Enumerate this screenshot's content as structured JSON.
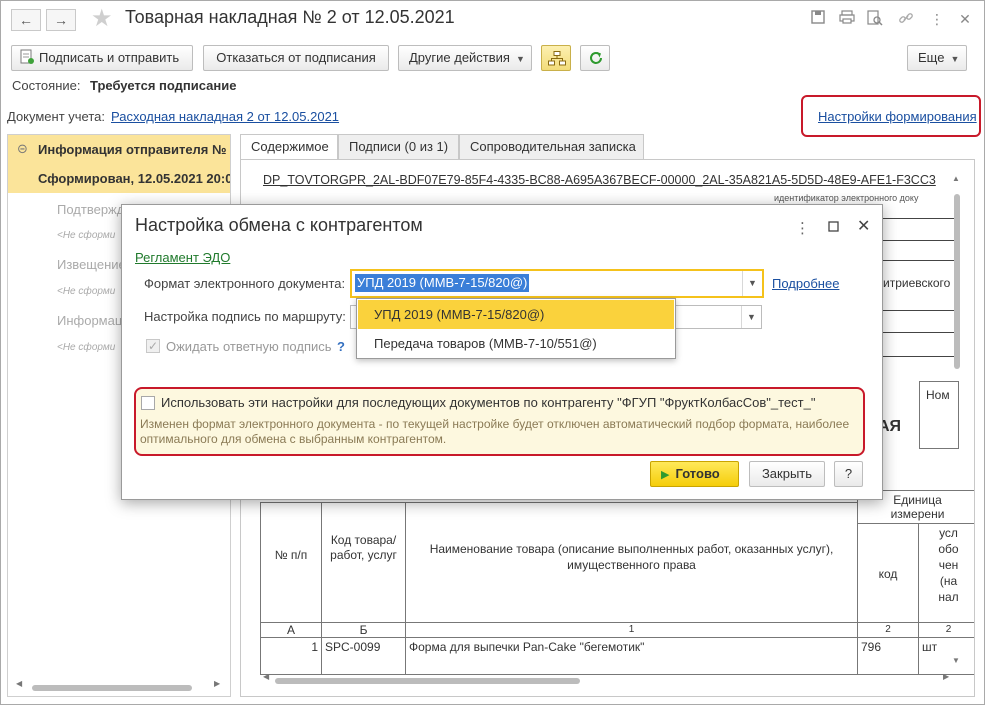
{
  "window": {
    "title": "Товарная накладная № 2 от 12.05.2021"
  },
  "toolbar": {
    "sign_send": "Подписать и отправить",
    "refuse_sign": "Отказаться от подписания",
    "other_actions": "Другие действия",
    "more": "Еще"
  },
  "state": {
    "label": "Состояние:",
    "value": "Требуется подписание"
  },
  "doc": {
    "label": "Документ учета:",
    "link": "Расходная накладная 2 от 12.05.2021",
    "settings_link": "Настройки формирования"
  },
  "left_panel": {
    "items": [
      {
        "text": "Информация отправителя №"
      },
      {
        "text": "Сформирован, 12.05.2021 20:0"
      },
      {
        "text": "Подтвержд"
      },
      {
        "text": "<Не сформи"
      },
      {
        "text": "Извещение"
      },
      {
        "text": "<Не сформи"
      },
      {
        "text": "Информац"
      },
      {
        "text": "<Не сформи"
      }
    ]
  },
  "tabs": [
    {
      "label": "Содержимое"
    },
    {
      "label": "Подписи (0 из 1)"
    },
    {
      "label": "Сопроводительная записка"
    }
  ],
  "document_preview": {
    "file_id": "DP_TOVTORGPR_2AL-BDF07E79-85F4-4335-BC88-A695A367BECF-00000_2AL-35A821A5-5D5D-48E9-AFE1-F3CC3",
    "id_caption": "идентификатор электронного доку",
    "partial_address": "итриевского",
    "partial_heading": "АЯ",
    "number_header": "Ном",
    "unit_header": "Единица",
    "unit_header2": "измерени",
    "table_headers": {
      "num": "№ п/п",
      "code": "Код товара/ работ, услуг",
      "name": "Наименование товара (описание выполненных работ, оказанных услуг), имущественного права",
      "code2": "код",
      "cond": [
        "усл",
        "обо",
        "чен",
        "(на",
        "нал"
      ]
    },
    "letters": [
      "А",
      "Б",
      "1",
      "2",
      "2"
    ],
    "row": {
      "num": "1",
      "code": "SPC-0099",
      "name": "Форма для выпечки Pan-Cake \"бегемотик\"",
      "unit_code": "796",
      "unit": "шт"
    }
  },
  "dialog": {
    "title": "Настройка обмена с контрагентом",
    "regulation_link": "Регламент ЭДО",
    "format_label": "Формат электронного документа:",
    "format_value": "УПД 2019 (ММВ-7-15/820@)",
    "details_link": "Подробнее",
    "route_label": "Настройка подпись по маршруту:",
    "wait_label": "Ожидать ответную подпись",
    "help_mark": "?",
    "use_settings": "Использовать эти настройки для последующих документов по контрагенту \"ФГУП \"ФруктКолбасСов\"_тест_\"",
    "notice": "Изменен формат электронного документа - по текущей настройке будет отключен автоматический подбор формата, наиболее оптимального для обмена с выбранным контрагентом.",
    "ok": "Готово",
    "close": "Закрыть",
    "help": "?"
  },
  "dropdown": {
    "options": [
      "УПД 2019 (ММВ-7-15/820@)",
      "Передача товаров (ММВ-7-10/551@)"
    ]
  },
  "colors": {
    "accent_yellow": "#f5cd0a",
    "highlight": "#fad23c",
    "alert_red": "#c8192a",
    "link_blue": "#1a4fa0",
    "link_green": "#207a2c"
  }
}
